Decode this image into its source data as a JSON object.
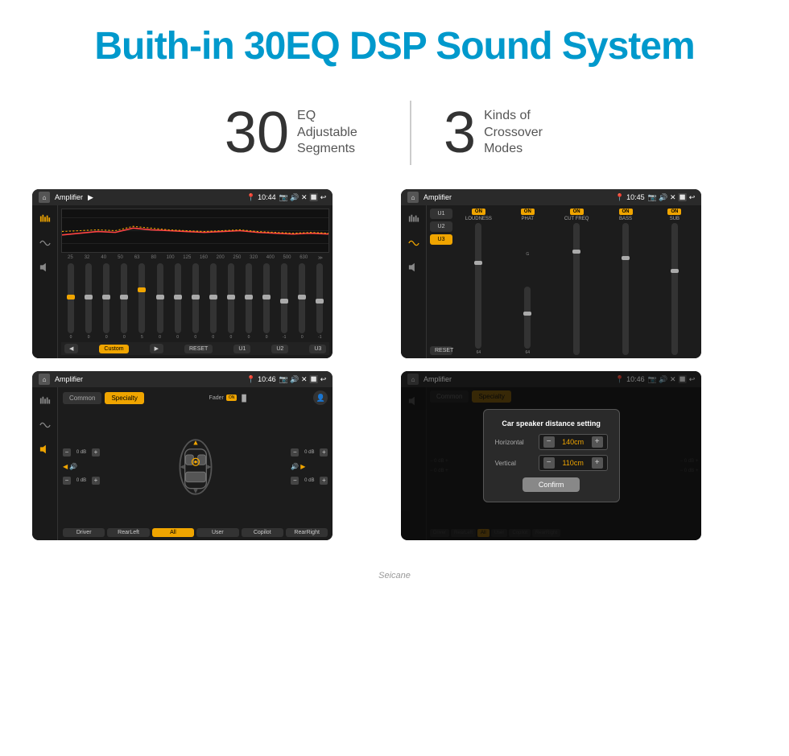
{
  "header": {
    "title": "Buith-in 30EQ DSP Sound System"
  },
  "stats": [
    {
      "number": "30",
      "desc": "EQ Adjustable\nSegments"
    },
    {
      "number": "3",
      "desc": "Kinds of\nCrossover Modes"
    }
  ],
  "screens": [
    {
      "id": "eq-screen",
      "time": "10:44",
      "title": "Amplifier",
      "type": "eq",
      "eq_labels": [
        "25",
        "32",
        "40",
        "50",
        "63",
        "80",
        "100",
        "125",
        "160",
        "200",
        "250",
        "320",
        "400",
        "500",
        "630"
      ],
      "eq_values": [
        "0",
        "0",
        "0",
        "0",
        "5",
        "0",
        "0",
        "0",
        "0",
        "0",
        "0",
        "0",
        "-1",
        "0",
        "-1"
      ],
      "bottom_buttons": [
        "Custom",
        "RESET",
        "U1",
        "U2",
        "U3"
      ]
    },
    {
      "id": "crossover-screen",
      "time": "10:45",
      "title": "Amplifier",
      "type": "crossover",
      "presets": [
        "U1",
        "U2",
        "U3"
      ],
      "channels": [
        {
          "label": "LOUDNESS",
          "on": true
        },
        {
          "label": "PHAT",
          "on": true
        },
        {
          "label": "CUT FREQ",
          "on": true
        },
        {
          "label": "BASS",
          "on": true
        },
        {
          "label": "SUB",
          "on": true
        }
      ]
    },
    {
      "id": "specialty-screen",
      "time": "10:46",
      "title": "Amplifier",
      "type": "specialty",
      "mode_tabs": [
        "Common",
        "Specialty"
      ],
      "active_tab": "Specialty",
      "fader_label": "Fader",
      "fader_on": true,
      "speaker_positions": [
        "FL",
        "FR",
        "RL",
        "RR"
      ],
      "db_values": [
        "0 dB",
        "0 dB",
        "0 dB",
        "0 dB"
      ],
      "bottom_buttons": [
        "Driver",
        "RearLeft",
        "All",
        "User",
        "Copilot",
        "RearRight"
      ]
    },
    {
      "id": "distance-screen",
      "time": "10:46",
      "title": "Amplifier",
      "type": "distance-dialog",
      "mode_tabs": [
        "Common",
        "Specialty"
      ],
      "active_tab": "Specialty",
      "dialog": {
        "title": "Car speaker distance setting",
        "rows": [
          {
            "label": "Horizontal",
            "value": "140cm"
          },
          {
            "label": "Vertical",
            "value": "110cm"
          }
        ],
        "confirm_label": "Confirm"
      }
    }
  ],
  "watermark": "Seicane"
}
